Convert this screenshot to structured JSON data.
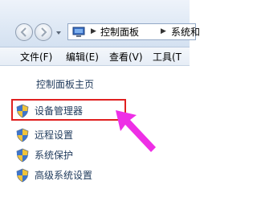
{
  "address": {
    "crumbs": [
      "控制面板",
      "系统和"
    ]
  },
  "menu": {
    "file": "文件(F)",
    "edit": "编辑(E)",
    "view": "查看(V)",
    "tools": "工具(T"
  },
  "left_pane": {
    "home": "控制面板主页",
    "tasks": [
      "设备管理器",
      "远程设置",
      "系统保护",
      "高级系统设置"
    ]
  },
  "annotation": {
    "highlight_color": "#e02020",
    "arrow_color": "#ee2fe6"
  }
}
